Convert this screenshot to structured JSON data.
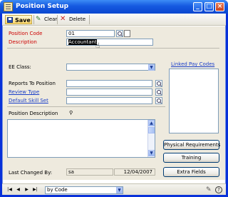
{
  "window": {
    "title": "Position Setup",
    "min_glyph": "_",
    "max_glyph": "□",
    "close_glyph": "×"
  },
  "toolbar": {
    "save_label": "Save",
    "clear_label": "Clear",
    "delete_label": "Delete",
    "save_icon": "floppy-disk-icon",
    "clear_icon": "clear-icon",
    "delete_icon": "x-icon"
  },
  "form": {
    "position_code_label": "Position Code",
    "position_code_value": "01",
    "description_label": "Description",
    "description_value": "Accountant",
    "ee_class_label": "EE Class:",
    "ee_class_value": "",
    "reports_to_label": "Reports To Position",
    "reports_to_value": "",
    "review_type_label": "Review Type",
    "review_type_value": "",
    "default_skill_set_label": "Default Skill Set",
    "default_skill_set_value": "",
    "position_description_label": "Position Description",
    "position_description_value": "",
    "linked_pay_codes_label": "Linked Pay Codes",
    "last_changed_label": "Last Changed By:",
    "last_changed_user": "sa",
    "last_changed_date": "12/04/2007"
  },
  "buttons": {
    "physical_requirements": "Physical Requirements",
    "training": "Training",
    "extra_fields": "Extra Fields"
  },
  "status": {
    "sort_value": "by Code",
    "nav_first": "|◀",
    "nav_prev": "◀",
    "nav_next": "▶",
    "nav_last": "▶|"
  },
  "colors": {
    "required_label": "#cc0000",
    "link": "#1a3fc9",
    "title_bar": "#0a47d0"
  }
}
